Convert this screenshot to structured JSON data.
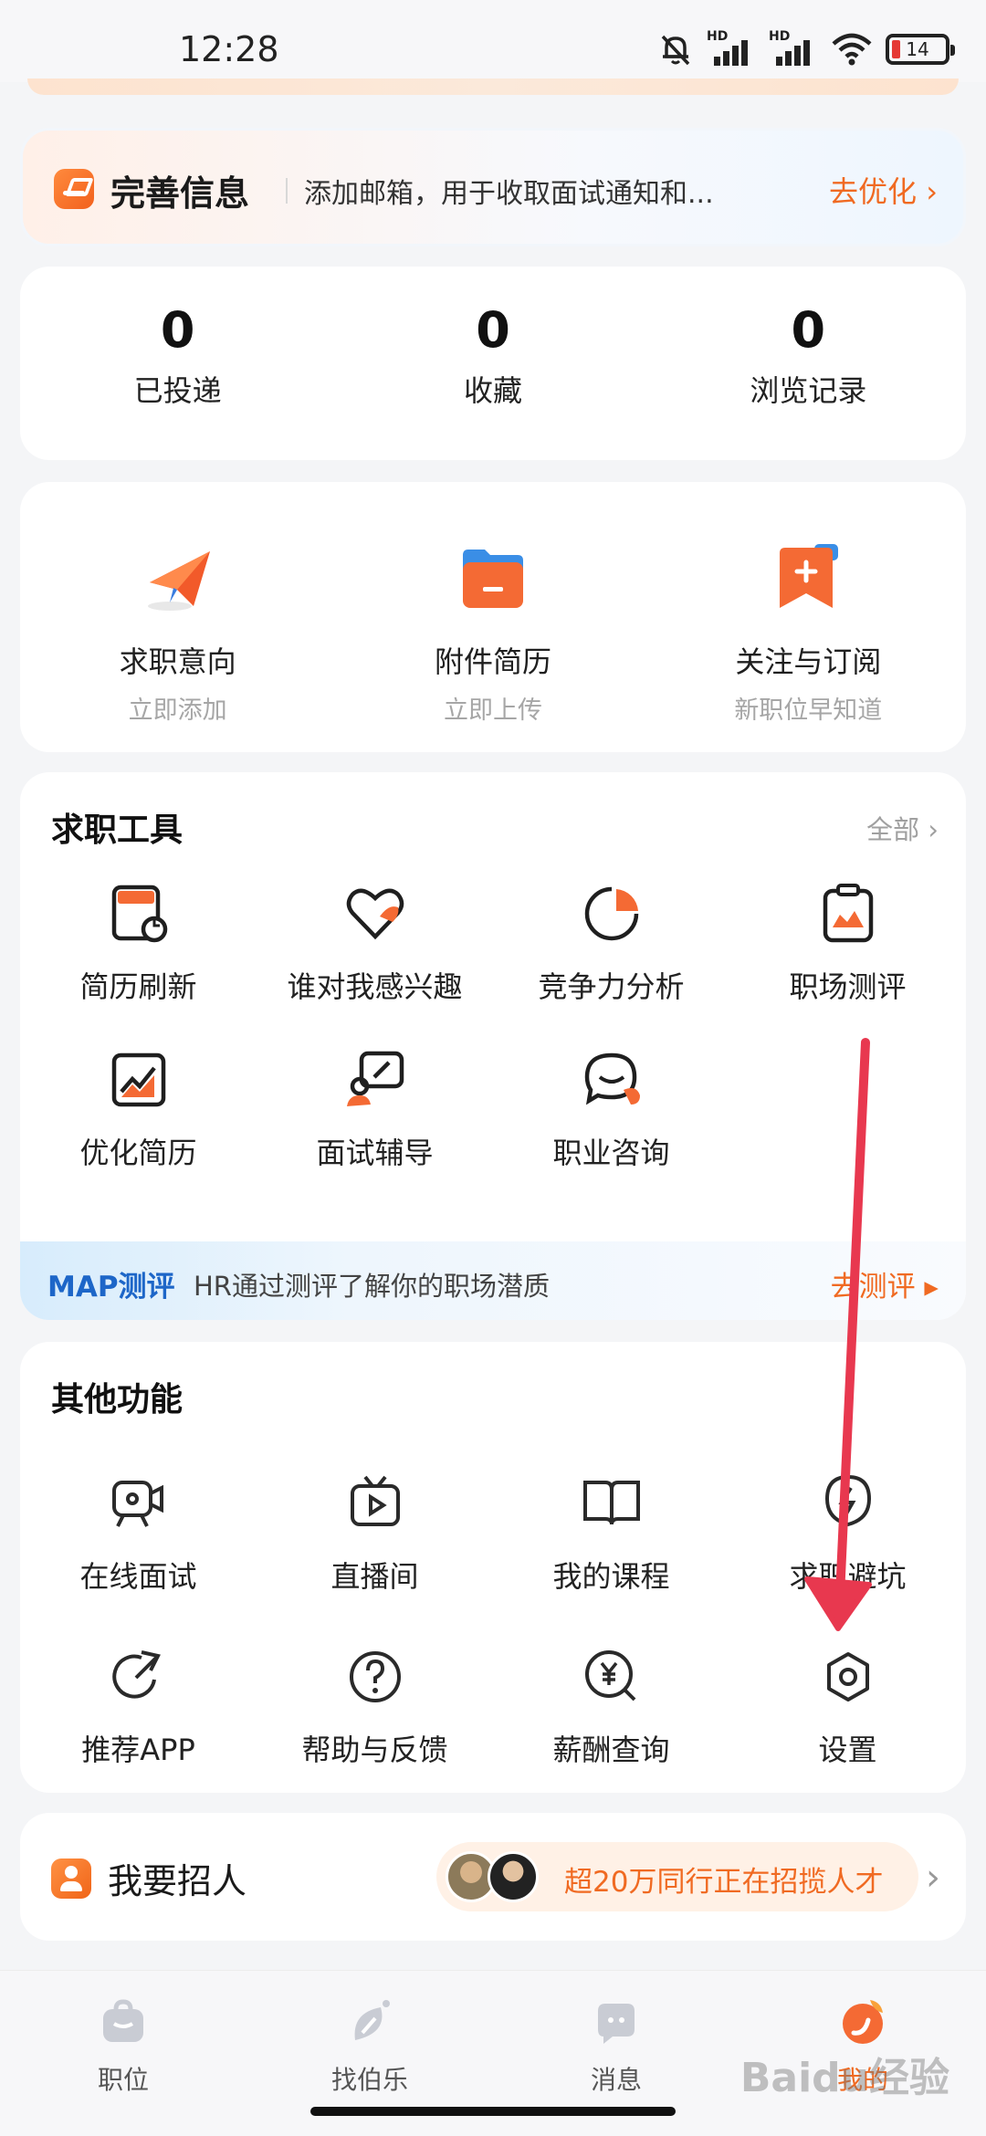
{
  "status_bar": {
    "time": "12:28",
    "battery": "14",
    "signal_label": "HD"
  },
  "profile_prompt": {
    "title": "完善信息",
    "text": "添加邮箱，用于收取面试通知和...",
    "action": "去优化 ›"
  },
  "stats": [
    {
      "value": "0",
      "label": "已投递"
    },
    {
      "value": "0",
      "label": "收藏"
    },
    {
      "value": "0",
      "label": "浏览记录"
    }
  ],
  "quick_actions": [
    {
      "label": "求职意向",
      "sub": "立即添加",
      "icon": "paper-plane-icon"
    },
    {
      "label": "附件简历",
      "sub": "立即上传",
      "icon": "folder-icon"
    },
    {
      "label": "关注与订阅",
      "sub": "新职位早知道",
      "icon": "bookmark-plus-icon"
    }
  ],
  "job_tools": {
    "title": "求职工具",
    "more": "全部 ›",
    "items": [
      {
        "label": "简历刷新",
        "icon": "resume-refresh-icon"
      },
      {
        "label": "谁对我感兴趣",
        "icon": "heart-icon"
      },
      {
        "label": "竞争力分析",
        "icon": "pie-chart-icon"
      },
      {
        "label": "职场测评",
        "icon": "clipboard-icon"
      },
      {
        "label": "优化简历",
        "icon": "chart-up-icon"
      },
      {
        "label": "面试辅导",
        "icon": "mentor-icon"
      },
      {
        "label": "职业咨询",
        "icon": "chat-bubble-icon"
      }
    ],
    "banner": {
      "tag": "MAP测评",
      "text": "HR通过测评了解你的职场潜质",
      "action": "去测评 ▸"
    }
  },
  "other_functions": {
    "title": "其他功能",
    "items": [
      {
        "label": "在线面试",
        "icon": "video-camera-icon"
      },
      {
        "label": "直播间",
        "icon": "live-tv-icon"
      },
      {
        "label": "我的课程",
        "icon": "book-icon"
      },
      {
        "label": "求职避坑",
        "icon": "shield-lightning-icon"
      },
      {
        "label": "推荐APP",
        "icon": "share-icon"
      },
      {
        "label": "帮助与反馈",
        "icon": "help-icon"
      },
      {
        "label": "薪酬查询",
        "icon": "salary-search-icon"
      },
      {
        "label": "设置",
        "icon": "settings-icon"
      }
    ]
  },
  "recruit": {
    "title": "我要招人",
    "note": "超20万同行正在招揽人才"
  },
  "tabs": [
    {
      "label": "职位",
      "icon": "briefcase-icon"
    },
    {
      "label": "找伯乐",
      "icon": "leaf-icon"
    },
    {
      "label": "消息",
      "icon": "message-icon"
    },
    {
      "label": "我的",
      "icon": "profile-flame-icon"
    }
  ],
  "watermark": "Baidu经验",
  "colors": {
    "accent": "#f06a22",
    "arrow": "#e8384f",
    "map_blue": "#1d66c8"
  }
}
